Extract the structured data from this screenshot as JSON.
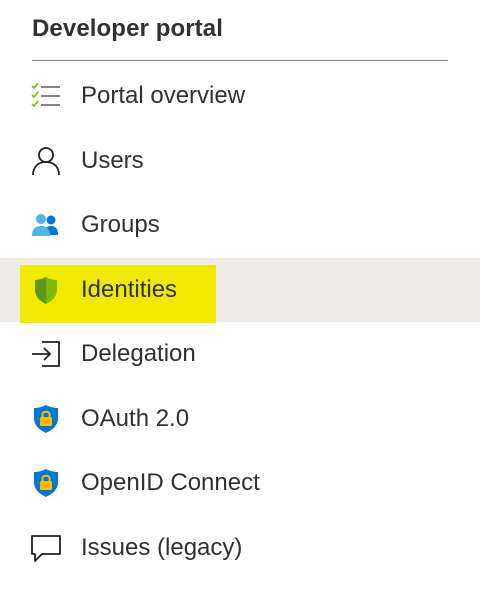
{
  "section": {
    "title": "Developer portal"
  },
  "nav": {
    "items": [
      {
        "label": "Portal overview",
        "icon": "checklist-icon",
        "selected": false
      },
      {
        "label": "Users",
        "icon": "user-icon",
        "selected": false
      },
      {
        "label": "Groups",
        "icon": "groups-icon",
        "selected": false
      },
      {
        "label": "Identities",
        "icon": "shield-icon",
        "selected": true
      },
      {
        "label": "Delegation",
        "icon": "sign-in-icon",
        "selected": false
      },
      {
        "label": "OAuth 2.0",
        "icon": "lock-shield-icon",
        "selected": false
      },
      {
        "label": "OpenID Connect",
        "icon": "lock-shield-icon",
        "selected": false
      },
      {
        "label": "Issues (legacy)",
        "icon": "speech-bubble-icon",
        "selected": false
      }
    ]
  },
  "colors": {
    "selected_background": "#edebe9",
    "highlight": "#f0ea00",
    "text": "#323130",
    "divider": "#8a8886",
    "shield_green": "#7fba00",
    "azure_blue": "#0078d4"
  }
}
